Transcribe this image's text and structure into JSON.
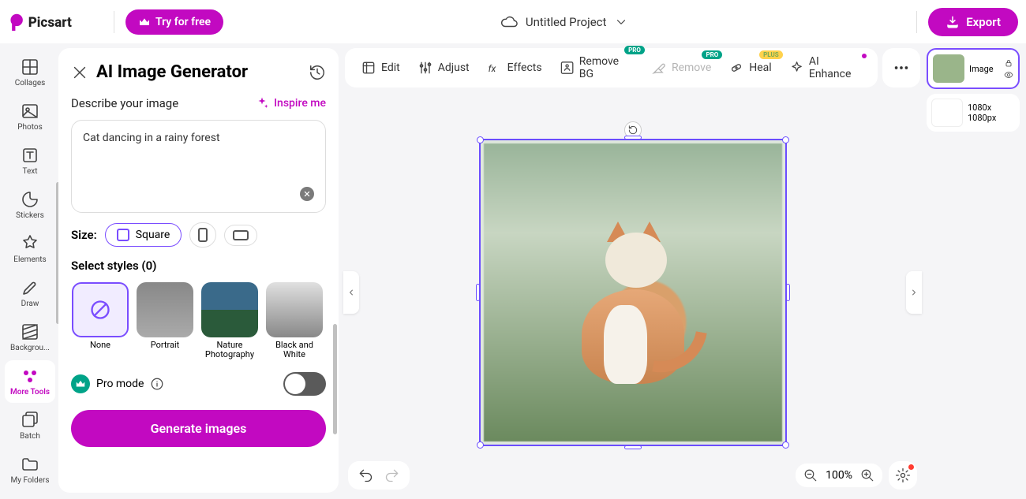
{
  "topbar": {
    "try_label": "Try for free",
    "project_title": "Untitled Project",
    "export_label": "Export"
  },
  "rail": {
    "items": [
      {
        "id": "collages",
        "label": "Collages"
      },
      {
        "id": "photos",
        "label": "Photos"
      },
      {
        "id": "text",
        "label": "Text"
      },
      {
        "id": "stickers",
        "label": "Stickers"
      },
      {
        "id": "elements",
        "label": "Elements"
      },
      {
        "id": "draw",
        "label": "Draw"
      },
      {
        "id": "background",
        "label": "Backgrou..."
      },
      {
        "id": "more-tools",
        "label": "More Tools"
      },
      {
        "id": "batch",
        "label": "Batch"
      },
      {
        "id": "my-folders",
        "label": "My Folders"
      }
    ],
    "active": "more-tools"
  },
  "panel": {
    "title": "AI Image Generator",
    "describe_label": "Describe your image",
    "inspire_label": "Inspire me",
    "prompt_value": "Cat dancing in a rainy forest",
    "size_label": "Size:",
    "sizes": [
      {
        "id": "square",
        "label": "Square"
      },
      {
        "id": "portrait",
        "label": ""
      },
      {
        "id": "landscape",
        "label": ""
      }
    ],
    "styles_label": "Select styles (0)",
    "styles": [
      {
        "id": "none",
        "label": "None"
      },
      {
        "id": "portrait",
        "label": "Portrait"
      },
      {
        "id": "nature",
        "label": "Nature Photography"
      },
      {
        "id": "bw",
        "label": "Black and White"
      }
    ],
    "pro_mode_label": "Pro mode",
    "pro_mode_on": false,
    "generate_label": "Generate images"
  },
  "toolbar": {
    "edit": "Edit",
    "adjust": "Adjust",
    "effects": "Effects",
    "remove_bg": "Remove BG",
    "remove": "Remove",
    "heal": "Heal",
    "ai_enhance": "AI Enhance",
    "badge_pro": "PRO",
    "badge_plus": "PLUS"
  },
  "zoom": {
    "value": "100%"
  },
  "layers": {
    "items": [
      {
        "id": "image",
        "label": "Image",
        "active": true
      },
      {
        "id": "canvas",
        "label": "1080x 1080px",
        "active": false
      }
    ]
  },
  "colors": {
    "accent": "#c209c1",
    "selection": "#7a4dff",
    "pro": "#00a388"
  }
}
